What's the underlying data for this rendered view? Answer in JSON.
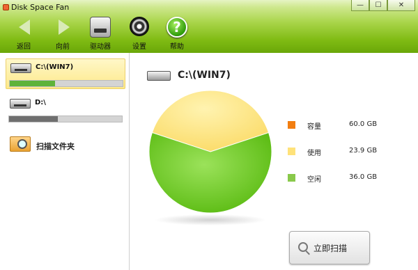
{
  "window": {
    "title": "Disk Space Fan",
    "minimize_glyph": "—",
    "maximize_glyph": "☐",
    "close_glyph": "✕"
  },
  "toolbar": {
    "back_label": "返回",
    "forward_label": "向前",
    "drives_label": "驱动器",
    "settings_label": "设置",
    "help_label": "帮助",
    "help_glyph": "?"
  },
  "sidebar": {
    "drives": [
      {
        "label": "C:\\(WIN7)",
        "used_fraction": 0.4,
        "bar_color": "#5fb33a"
      },
      {
        "label": "D:\\",
        "used_fraction": 0.43,
        "bar_color": "#6f6f6f"
      }
    ],
    "scan_folder_label": "扫描文件夹"
  },
  "main": {
    "drive_title": "C:\\(WIN7)",
    "legend": [
      {
        "name": "容量",
        "value": "60.0 GB",
        "color": "#f27e11"
      },
      {
        "name": "使用",
        "value": "23.9 GB",
        "color": "#ffe27a"
      },
      {
        "name": "空闲",
        "value": "36.0 GB",
        "color": "#89c94b"
      }
    ],
    "scan_now_label": "立即扫描"
  },
  "chart_data": {
    "type": "pie",
    "labels": [
      "使用",
      "空闲"
    ],
    "values": [
      23.9,
      36.0
    ],
    "colors": [
      "#ffe27a",
      "#6cc418"
    ]
  }
}
